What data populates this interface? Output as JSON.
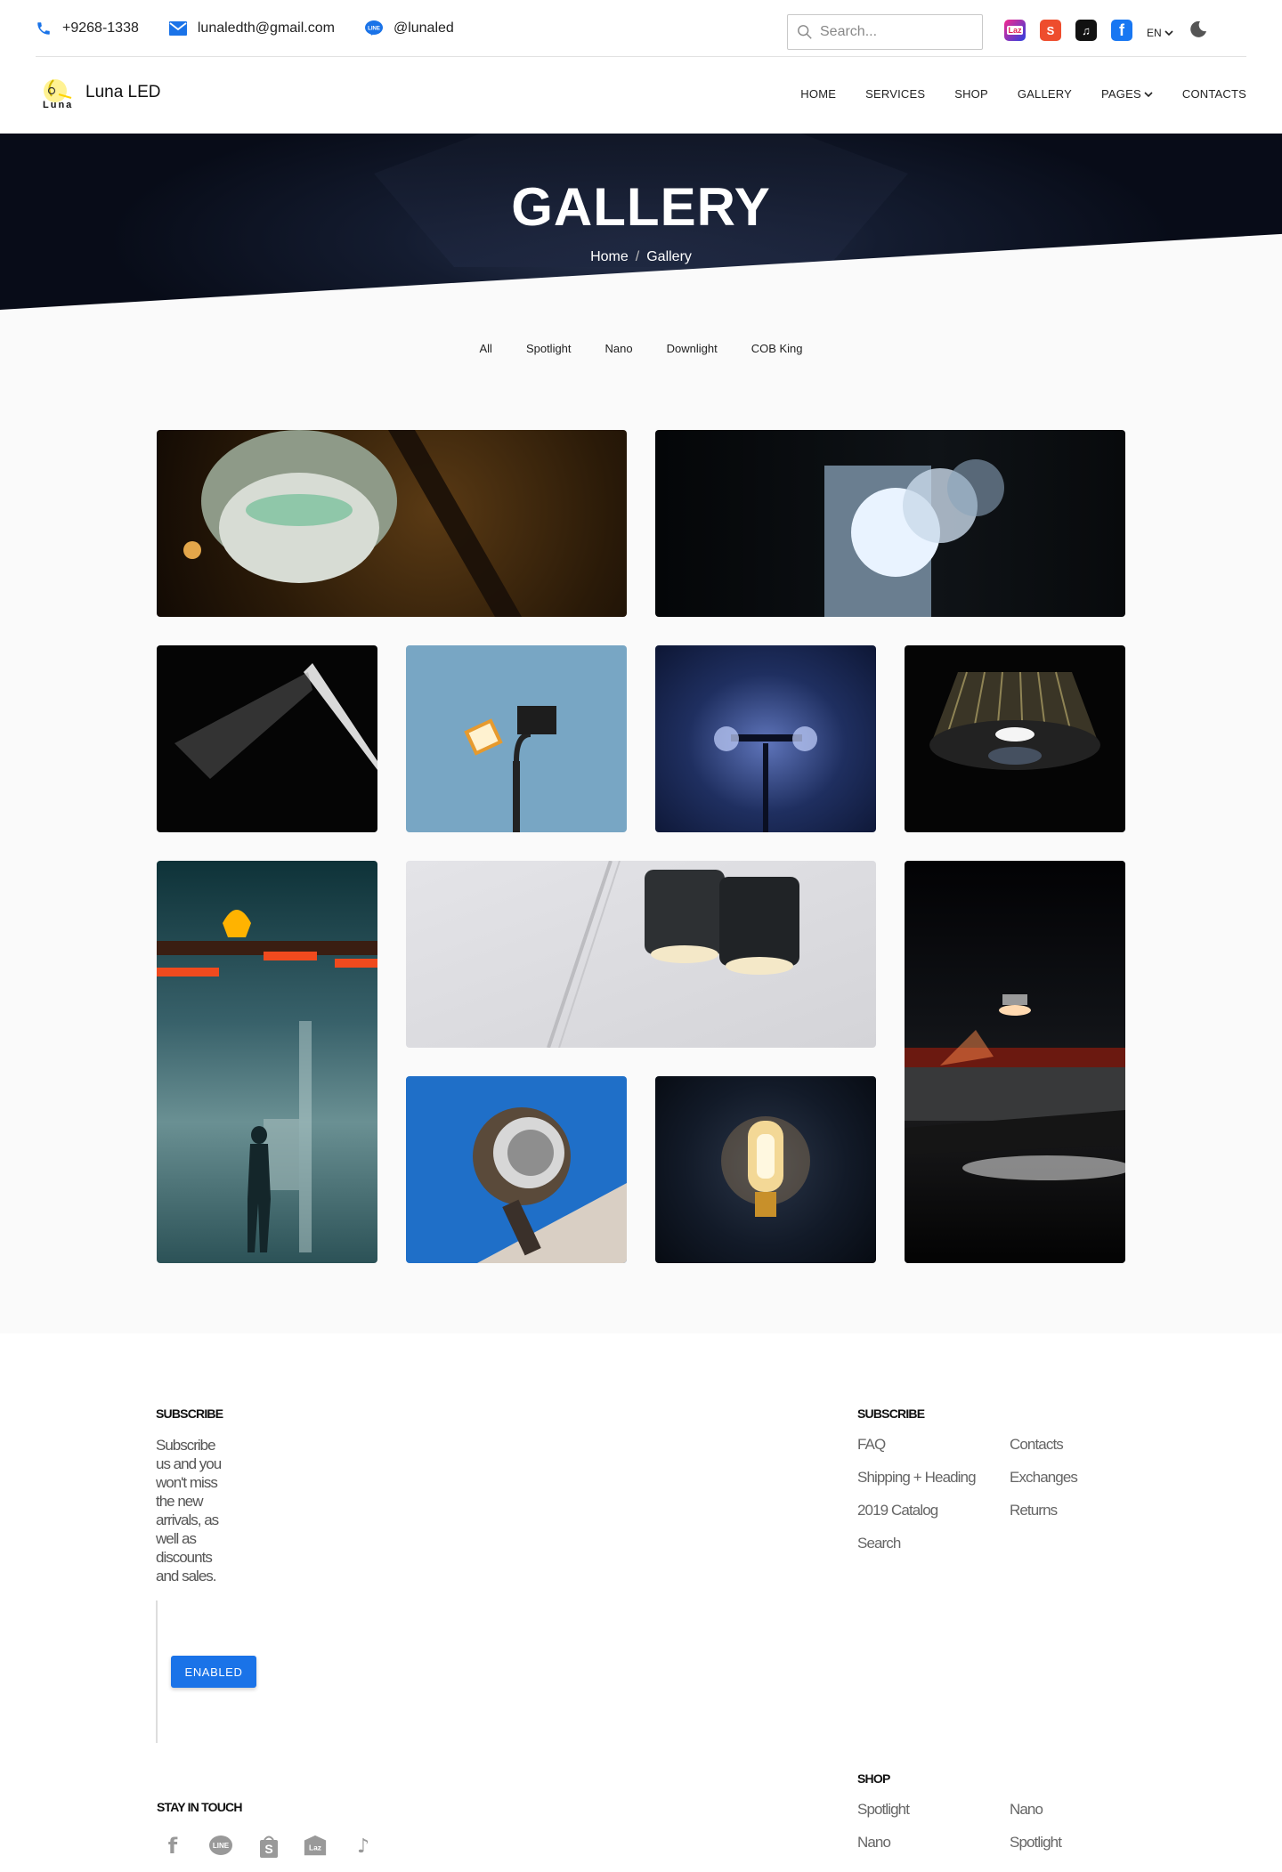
{
  "topbar": {
    "phone": "+9268-1338",
    "email": "lunaledth@gmail.com",
    "line_id": "@lunaled",
    "search_placeholder": "Search...",
    "language": "EN"
  },
  "navbar": {
    "brand": "Luna LED",
    "logo_text": "Luna",
    "items": [
      "HOME",
      "SERVICES",
      "SHOP",
      "GALLERY",
      "PAGES",
      "CONTACTS"
    ]
  },
  "hero": {
    "title": "GALLERY",
    "breadcrumb_home": "Home",
    "breadcrumb_sep": "/",
    "breadcrumb_current": "Gallery"
  },
  "filters": [
    "All",
    "Spotlight",
    "Nano",
    "Downlight",
    "COB King"
  ],
  "gallery": [
    {
      "name": "gallery-image-ceiling-lamp"
    },
    {
      "name": "gallery-image-wall-light"
    },
    {
      "name": "gallery-image-street-lamp-beam"
    },
    {
      "name": "gallery-image-floodlight-sky"
    },
    {
      "name": "gallery-image-blue-lamp-post"
    },
    {
      "name": "gallery-image-pendant-lamp"
    },
    {
      "name": "gallery-image-gas-station"
    },
    {
      "name": "gallery-image-ceiling-spotlights"
    },
    {
      "name": "gallery-image-parking-light"
    },
    {
      "name": "gallery-image-searchlight"
    },
    {
      "name": "gallery-image-bulb"
    }
  ],
  "footer": {
    "subscribe_heading": "SUBSCRIBE",
    "subscribe_text": "Subscribe us and you won't miss the new arrivals, as well as discounts and sales.",
    "enable_button": "ENABLED",
    "links_heading": "SUBSCRIBE",
    "links_col1": [
      "FAQ",
      "Shipping + Heading",
      "2019 Catalog",
      "Search"
    ],
    "links_col2": [
      "Contacts",
      "Exchanges",
      "Returns"
    ],
    "shop_heading": "SHOP",
    "shop_col1": [
      "Spotlight",
      "Nano"
    ],
    "shop_col2": [
      "Nano",
      "Spotlight"
    ],
    "stay_heading": "STAY IN TOUCH"
  },
  "colors": {
    "accent": "#1a73e8",
    "hero_dark": "#0b1020"
  }
}
